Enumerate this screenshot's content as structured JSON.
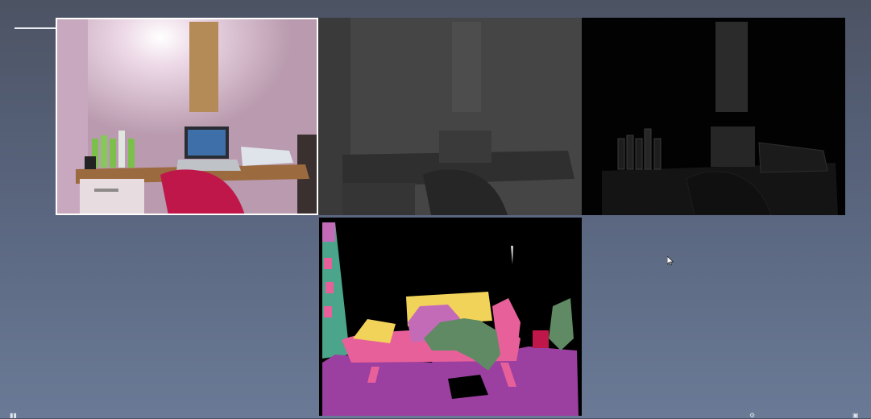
{
  "slide": {
    "panels": [
      {
        "id": "rgb",
        "caption": ""
      },
      {
        "id": "depth",
        "caption": ""
      },
      {
        "id": "instance",
        "caption": ""
      },
      {
        "id": "segmentation",
        "caption": ""
      }
    ]
  },
  "colors": {
    "background_top": "#4c5363",
    "background_bottom": "#6a7a96",
    "seg_pink": "#e8609a",
    "seg_yellow": "#f2d35a",
    "seg_purple": "#9b3fa0",
    "seg_green": "#5f8a63",
    "seg_teal": "#4aa58a",
    "seg_lilac": "#c46bb8"
  },
  "icons": [
    "cursor-icon",
    "play-icon",
    "settings-icon",
    "fullscreen-icon"
  ]
}
